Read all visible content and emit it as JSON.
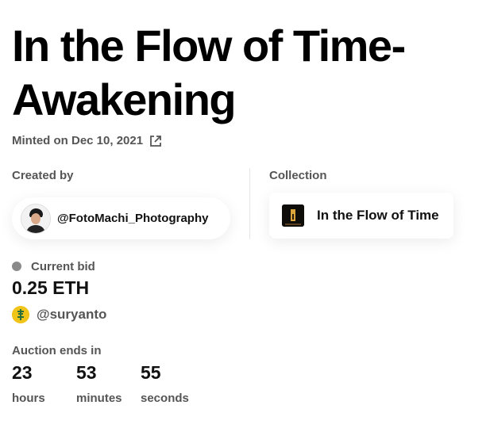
{
  "artwork": {
    "title": "In the Flow of Time- Awakening",
    "minted_text": "Minted on Dec 10, 2021",
    "external_link_icon": "external-link-icon"
  },
  "creator": {
    "label": "Created by",
    "handle": "@FotoMachi_Photography",
    "avatar_icon": "creator-avatar"
  },
  "collection": {
    "label": "Collection",
    "name": "In the Flow of Time",
    "thumb_icon": "collection-thumbnail"
  },
  "bid": {
    "label": "Current bid",
    "amount": "0.25 ETH",
    "bidder_handle": "@suryanto",
    "status_dot_color": "#8a8a8a"
  },
  "auction": {
    "label": "Auction ends in",
    "countdown": [
      {
        "value": "23",
        "unit": "hours"
      },
      {
        "value": "53",
        "unit": "minutes"
      },
      {
        "value": "55",
        "unit": "seconds"
      }
    ]
  }
}
